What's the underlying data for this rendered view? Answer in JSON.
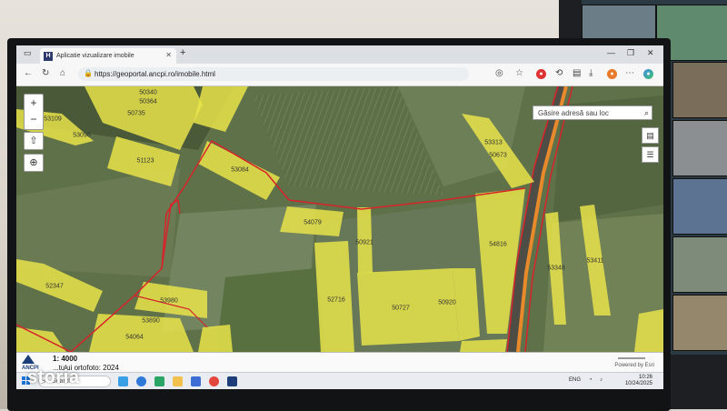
{
  "browser": {
    "tab_title": "Aplicatie vizualizare imobile",
    "tab_logo": "H",
    "url": "https://geoportal.ancpi.ro/imobile.html"
  },
  "map": {
    "search_placeholder": "Găsire adresă sau loc",
    "parcels": [
      {
        "id": "50340"
      },
      {
        "id": "50364"
      },
      {
        "id": "50735"
      },
      {
        "id": "53109"
      },
      {
        "id": "53098"
      },
      {
        "id": "51123"
      },
      {
        "id": "53084"
      },
      {
        "id": "54079"
      },
      {
        "id": "50921"
      },
      {
        "id": "53313"
      },
      {
        "id": "50673"
      },
      {
        "id": "54816"
      },
      {
        "id": "53348"
      },
      {
        "id": "53411"
      },
      {
        "id": "52347"
      },
      {
        "id": "53980"
      },
      {
        "id": "53890"
      },
      {
        "id": "54064"
      },
      {
        "id": "52716"
      },
      {
        "id": "50727"
      },
      {
        "id": "50920"
      }
    ],
    "parcel_color": "#e8e34a",
    "boundary_color": "#d8232a"
  },
  "footer": {
    "scale": "1: 4000",
    "ortho": "...tului ortofoto: 2024",
    "logo": "ANCPI",
    "powered": "Powered by Esri"
  },
  "taskbar": {
    "search": "Search",
    "lang": "ENG",
    "time": "10:26",
    "date": "10/24/2025"
  },
  "watermark": "storia"
}
